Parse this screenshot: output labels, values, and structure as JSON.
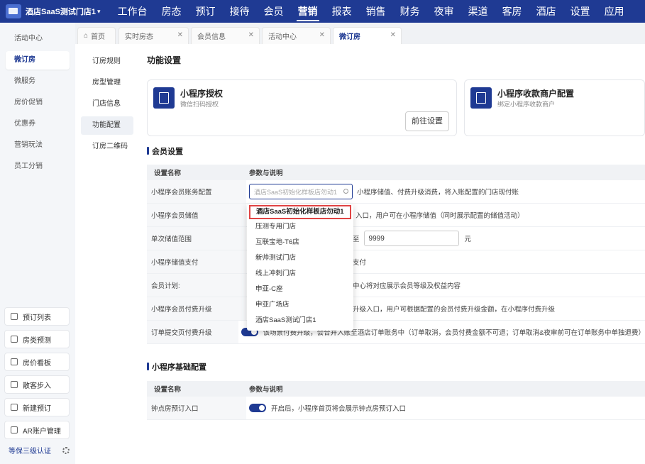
{
  "topbar": {
    "store_name": "酒店SaaS测试门店1",
    "nav": [
      "工作台",
      "房态",
      "预订",
      "接待",
      "会员",
      "营销",
      "报表",
      "销售",
      "财务",
      "夜审",
      "渠道",
      "客房",
      "酒店",
      "设置",
      "应用"
    ],
    "active_nav": "营销"
  },
  "sidebar": {
    "items": [
      "活动中心",
      "微订房",
      "微服务",
      "房价促销",
      "优惠券",
      "营销玩法",
      "员工分销"
    ],
    "active": "微订房",
    "quick": [
      "预订列表",
      "房类预测",
      "房价看板",
      "散客步入",
      "新建预订",
      "AR账户管理"
    ],
    "security": "等保三级认证"
  },
  "tabs": [
    {
      "label": "首页"
    },
    {
      "label": "实时房态"
    },
    {
      "label": "会员信息"
    },
    {
      "label": "活动中心"
    },
    {
      "label": "微订房"
    }
  ],
  "subnav": {
    "items": [
      "订房规则",
      "房型管理",
      "门店信息",
      "功能配置",
      "订房二维码"
    ],
    "active": "功能配置"
  },
  "main": {
    "title": "功能设置",
    "card1": {
      "title": "小程序授权",
      "sub": "微信扫码授权",
      "button": "前往设置"
    },
    "card2": {
      "title": "小程序收款商户配置",
      "sub": "绑定小程序收款商户"
    },
    "member_section": "会员设置",
    "col1": "设置名称",
    "col2": "参数与说明",
    "rows": [
      {
        "name": "小程序会员账务配置",
        "desc": "小程序储值、付费升级消费，将入账配置的门店现付账",
        "search_placeholder": "酒店SaaS初始化样板店勿动1"
      },
      {
        "name": "小程序会员储值",
        "desc": "入口，用户可在小程序储值（同时展示配置的储值活动）"
      },
      {
        "name": "单次储值范围",
        "to": "至",
        "max": "9999",
        "unit": "元"
      },
      {
        "name": "小程序储值支付",
        "desc": "支付"
      },
      {
        "name": "会员计划:",
        "desc": "中心将对应展示会员等级及权益内容"
      },
      {
        "name": "小程序会员付费升级",
        "desc": "升级入口，用户可根据配置的会员付费升级金额，在小程序付费升级"
      },
      {
        "name": "订单提交页付费升级",
        "desc": "该场景付费升级，会合并入账至酒店订单账务中（订单取消，会员付费金额不可退；订单取消&夜审前可在订单账务中单独退费）"
      }
    ],
    "mini_section": "小程序基础配置",
    "mini_rows": [
      {
        "name": "钟点房预订入口",
        "desc": "开启后，小程序首页将会展示钟点房预订入口"
      }
    ]
  },
  "dropdown": {
    "options": [
      "酒店SaaS初始化样板店勿动1",
      "压测专用门店",
      "互联宝地-T6店",
      "新帅测试门店",
      "线上冲刺门店",
      "申亚-C座",
      "申亚广场店",
      "酒店SaaS测试门店1"
    ],
    "selected": "酒店SaaS初始化样板店勿动1"
  },
  "colors": {
    "primary": "#1f3a93",
    "highlight": "#e04444"
  }
}
